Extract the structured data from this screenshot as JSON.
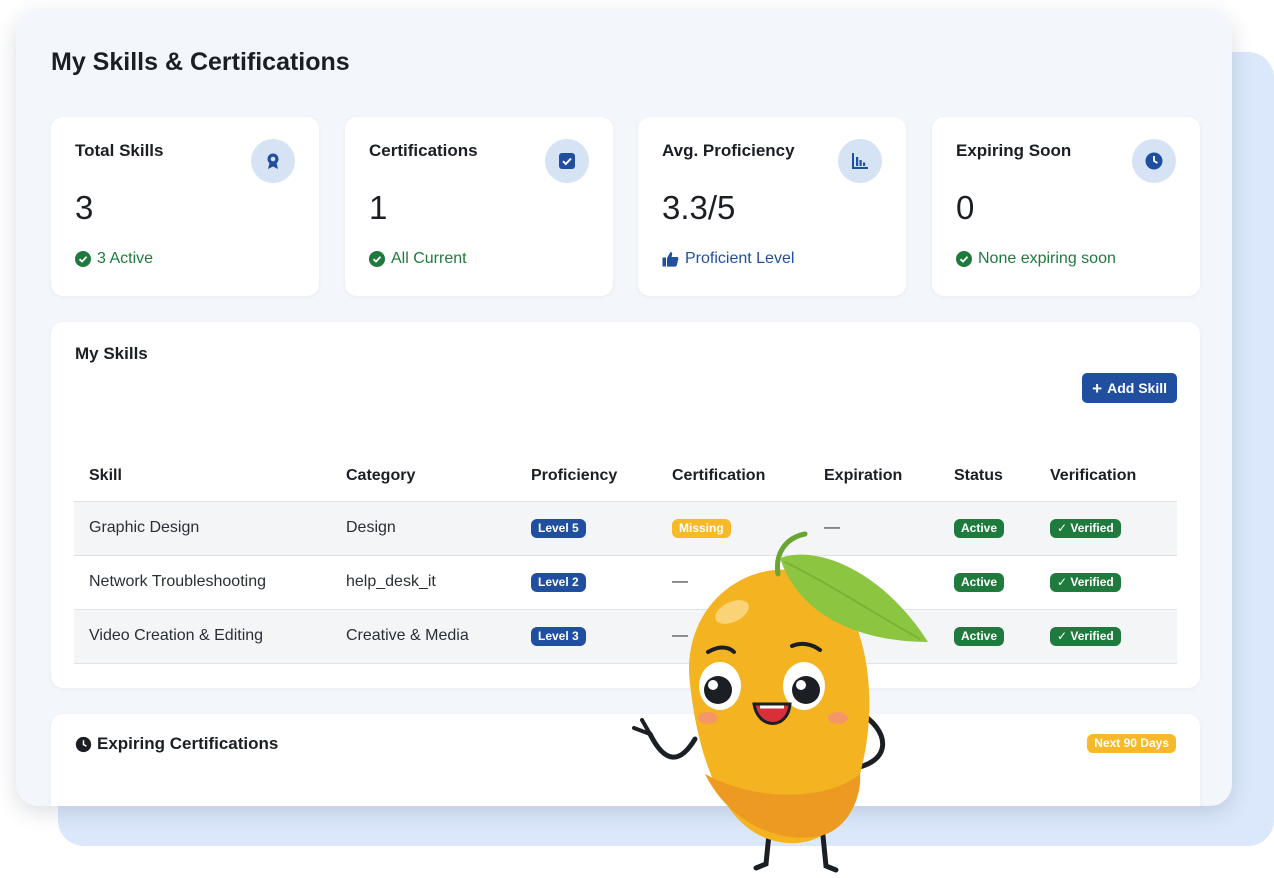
{
  "page": {
    "title": "My Skills & Certifications"
  },
  "stats": [
    {
      "title": "Total Skills",
      "value": "3",
      "foot": "3 Active",
      "icon": "award-icon"
    },
    {
      "title": "Certifications",
      "value": "1",
      "foot": "All Current",
      "icon": "checkbox-icon"
    },
    {
      "title": "Avg. Proficiency",
      "value": "3.3/5",
      "foot": "Proficient Level",
      "icon": "bar-chart-icon"
    },
    {
      "title": "Expiring Soon",
      "value": "0",
      "foot": "None expiring soon",
      "icon": "clock-icon"
    }
  ],
  "skills": {
    "title": "My Skills",
    "add_label": "Add Skill",
    "columns": [
      "Skill",
      "Category",
      "Proficiency",
      "Certification",
      "Expiration",
      "Status",
      "Verification"
    ],
    "rows": [
      {
        "skill": "Graphic Design",
        "category": "Design",
        "proficiency": "Level 5",
        "certification": "Missing",
        "expiration": "—",
        "status": "Active",
        "verification": "Verified"
      },
      {
        "skill": "Network Troubleshooting",
        "category": "help_desk_it",
        "proficiency": "Level 2",
        "certification": "—",
        "expiration": "",
        "status": "Active",
        "verification": "Verified"
      },
      {
        "skill": "Video Creation & Editing",
        "category": "Creative & Media",
        "proficiency": "Level 3",
        "certification": "—",
        "expiration": "",
        "status": "Active",
        "verification": "Verified"
      }
    ]
  },
  "expiring": {
    "title": "Expiring Certifications",
    "badge": "Next 90 Days"
  },
  "colors": {
    "primary": "#1f4f9e",
    "success": "#1f7a3d",
    "warning": "#f7b928",
    "panel": "#f3f6fa"
  }
}
